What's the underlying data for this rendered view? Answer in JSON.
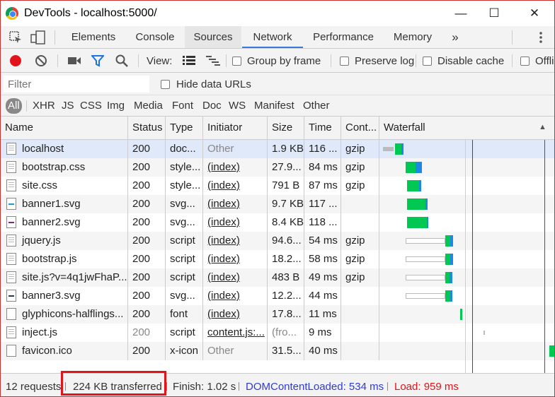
{
  "window": {
    "title": "DevTools - localhost:5000/",
    "minimize": "—",
    "maximize": "☐",
    "close": "✕"
  },
  "tabs": [
    "Elements",
    "Console",
    "Sources",
    "Network",
    "Performance",
    "Memory"
  ],
  "tabs_more": "»",
  "toolbar": {
    "view_label": "View:",
    "group_by_frame": "Group by frame",
    "preserve_log": "Preserve log",
    "disable_cache": "Disable cache",
    "offline": "Offli"
  },
  "filter": {
    "placeholder": "Filter",
    "hide_data_urls": "Hide data URLs"
  },
  "type_filters": [
    "All",
    "XHR",
    "JS",
    "CSS",
    "Img",
    "Media",
    "Font",
    "Doc",
    "WS",
    "Manifest",
    "Other"
  ],
  "columns": [
    "Name",
    "Status",
    "Type",
    "Initiator",
    "Size",
    "Time",
    "Cont...",
    "Waterfall"
  ],
  "sort_indicator": "▲",
  "rows": [
    {
      "name": "localhost",
      "status": "200",
      "type": "doc...",
      "initiator": "Other",
      "size": "1.9 KB",
      "time": "116 ...",
      "content": "gzip",
      "icon": "doc"
    },
    {
      "name": "bootstrap.css",
      "status": "200",
      "type": "style...",
      "initiator": "(index)",
      "size": "27.9...",
      "time": "84 ms",
      "content": "gzip",
      "icon": "doc"
    },
    {
      "name": "site.css",
      "status": "200",
      "type": "style...",
      "initiator": "(index)",
      "size": "791 B",
      "time": "87 ms",
      "content": "gzip",
      "icon": "doc"
    },
    {
      "name": "banner1.svg",
      "status": "200",
      "type": "svg...",
      "initiator": "(index)",
      "size": "9.7 KB",
      "time": "117 ...",
      "content": "",
      "icon": "svg-blue"
    },
    {
      "name": "banner2.svg",
      "status": "200",
      "type": "svg...",
      "initiator": "(index)",
      "size": "8.4 KB",
      "time": "118 ...",
      "content": "",
      "icon": "svg-purple"
    },
    {
      "name": "jquery.js",
      "status": "200",
      "type": "script",
      "initiator": "(index)",
      "size": "94.6...",
      "time": "54 ms",
      "content": "gzip",
      "icon": "doc"
    },
    {
      "name": "bootstrap.js",
      "status": "200",
      "type": "script",
      "initiator": "(index)",
      "size": "18.2...",
      "time": "58 ms",
      "content": "gzip",
      "icon": "doc"
    },
    {
      "name": "site.js?v=4q1jwFhaP...",
      "status": "200",
      "type": "script",
      "initiator": "(index)",
      "size": "483 B",
      "time": "49 ms",
      "content": "gzip",
      "icon": "doc"
    },
    {
      "name": "banner3.svg",
      "status": "200",
      "type": "svg...",
      "initiator": "(index)",
      "size": "12.2...",
      "time": "44 ms",
      "content": "",
      "icon": "svg-navy"
    },
    {
      "name": "glyphicons-halflings...",
      "status": "200",
      "type": "font",
      "initiator": "(index)",
      "size": "17.8...",
      "time": "11 ms",
      "content": "",
      "icon": "plain"
    },
    {
      "name": "inject.js",
      "status": "200",
      "type": "script",
      "initiator": "content.js:...",
      "size": "(fro...",
      "time": "9 ms",
      "content": "",
      "icon": "doc"
    },
    {
      "name": "favicon.ico",
      "status": "200",
      "type": "x-icon",
      "initiator": "Other",
      "size": "31.5...",
      "time": "40 ms",
      "content": "",
      "icon": "plain"
    }
  ],
  "status": {
    "requests": "12 requests",
    "transferred": "224 KB transferred",
    "finish": "Finish: 1.02 s",
    "dom_content_loaded": "DOMContentLoaded: 534 ms",
    "load": "Load: 959 ms"
  },
  "colors": {
    "dcl_line": "#2f3bd6",
    "load_line": "#e2141b",
    "highlight": "#e2141b",
    "tab_active": "#3879d9"
  }
}
